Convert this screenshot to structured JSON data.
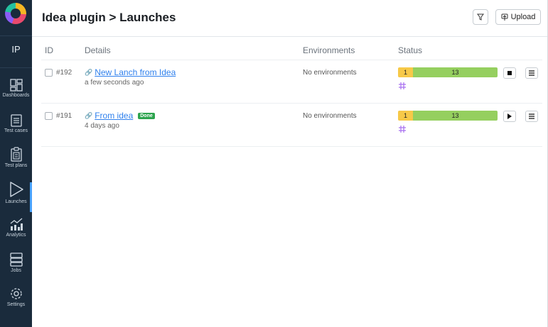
{
  "sidebar": {
    "project_initials": "IP",
    "items": [
      {
        "label": "Dashboards",
        "icon": "dashboards-icon"
      },
      {
        "label": "Test cases",
        "icon": "test-cases-icon"
      },
      {
        "label": "Test plans",
        "icon": "test-plans-icon"
      },
      {
        "label": "Launches",
        "icon": "launches-icon",
        "active": true
      },
      {
        "label": "Analytics",
        "icon": "analytics-icon"
      },
      {
        "label": "Jobs",
        "icon": "jobs-icon"
      },
      {
        "label": "Settings",
        "icon": "settings-icon"
      }
    ]
  },
  "header": {
    "breadcrumb": "Idea plugin > Launches",
    "upload_label": "Upload"
  },
  "table": {
    "columns": [
      "ID",
      "Details",
      "Environments",
      "Status"
    ],
    "rows": [
      {
        "id": "#192",
        "name": "New Lanch from Idea",
        "badge": "",
        "time": "a few seconds ago",
        "environments": "No environments",
        "status_yellow": "1",
        "status_green": "13",
        "action": "stop"
      },
      {
        "id": "#191",
        "name": "From idea",
        "badge": "Done",
        "time": "4 days ago",
        "environments": "No environments",
        "status_yellow": "1",
        "status_green": "13",
        "action": "play"
      }
    ]
  },
  "colors": {
    "sidebar_bg": "#1a2b3c",
    "accent": "#4aa3ff",
    "link": "#2f80ed",
    "done_badge": "#2da44e",
    "status_yellow": "#f7c948",
    "status_green": "#95cf5f"
  }
}
